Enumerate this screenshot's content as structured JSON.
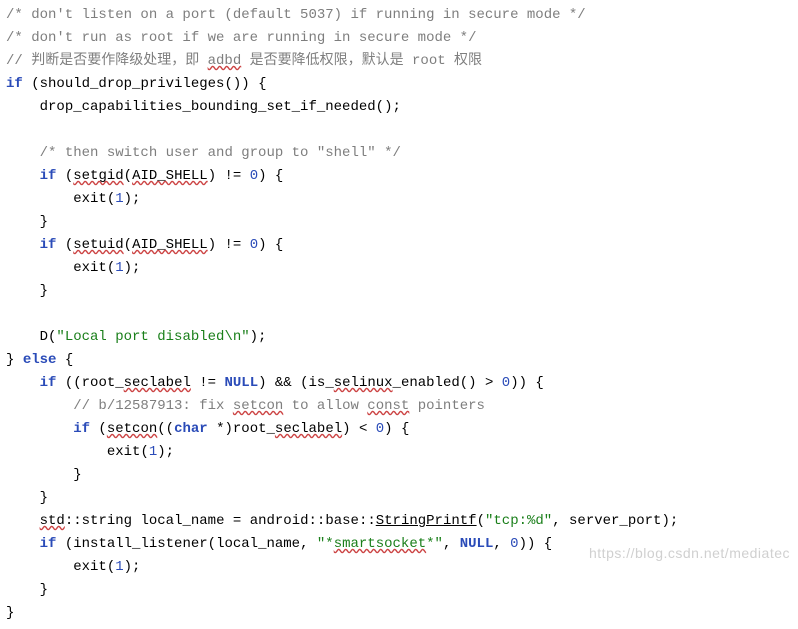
{
  "code": {
    "c1": "/* don't listen on a port (default 5037) if running in secure mode */",
    "c2": "/* don't run as root if we are running in secure mode */",
    "c3_a": "// 判断是否要作降级处理，即 ",
    "c3_adbd": "adbd",
    "c3_b": " 是否要降低权限，默认是 root 权限",
    "fn_should": "should_drop_privileges",
    "fn_dropcaps": "drop_capabilities_bounding_set_if_needed",
    "c4": "/* then switch user and group to \"shell\" */",
    "id_setgid": "setgid",
    "id_setuid": "setuid",
    "id_aid": "AID_SHELL",
    "exit": "exit",
    "zero": "0",
    "one": "1",
    "d_str": "\"Local port disabled\\n\"",
    "root_seclabel_a": "root",
    "root_seclabel_b": "seclabel",
    "null": "NULL",
    "is_selinux_a": "is",
    "is_selinux_b": "selinux",
    "is_selinux_c": "enabled",
    "c5_a": "// b/12587913: fix ",
    "c5_setcon": "setcon",
    "c5_b": " to allow ",
    "c5_const": "const",
    "c5_c": " pointers",
    "setcon": "setcon",
    "char": "char",
    "std_ns": "std",
    "string_t": "string",
    "local_name": "local_name",
    "android_ns": "android",
    "base_ns": "base",
    "stringprintf": "StringPrintf",
    "tcp_fmt": "\"tcp:%d\"",
    "server_port": "server_port",
    "install_listener": "install_listener",
    "smartsocket": "\"*smartsocket*\"",
    "k_if": "if",
    "k_else": "else"
  },
  "watermark": "https://blog.csdn.net/mediatec"
}
